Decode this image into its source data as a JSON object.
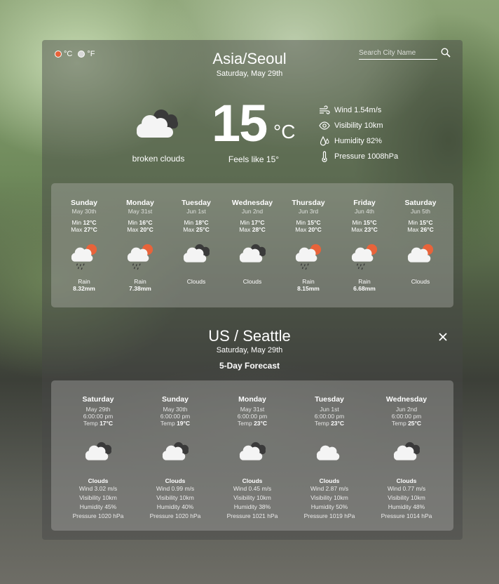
{
  "units": {
    "celsius": "°C",
    "fahrenheit": "°F",
    "celsius_color": "#e8633a",
    "fahrenheit_color": "#d8d8d8"
  },
  "search": {
    "placeholder": "Search City Name"
  },
  "current": {
    "city": "Asia/Seoul",
    "date": "Saturday, May 29th",
    "temp": "15",
    "temp_unit": "°C",
    "description": "broken clouds",
    "feels_like": "Feels like 15°",
    "icon": "cloud-dark-icon",
    "details": {
      "wind": "Wind 1.54m/s",
      "visibility": "Visibility 10km",
      "humidity": "Humidity 82%",
      "pressure": "Pressure 1008hPa"
    }
  },
  "week": [
    {
      "day": "Sunday",
      "date": "May 30th",
      "min_label": "Min",
      "min": "12°C",
      "max_label": "Max",
      "max": "27°C",
      "icon": "rain-sun-icon",
      "condition": "Rain",
      "amount": "8.32mm"
    },
    {
      "day": "Monday",
      "date": "May 31st",
      "min_label": "Min",
      "min": "16°C",
      "max_label": "Max",
      "max": "20°C",
      "icon": "rain-sun-icon",
      "condition": "Rain",
      "amount": "7.38mm"
    },
    {
      "day": "Tuesday",
      "date": "Jun 1st",
      "min_label": "Min",
      "min": "18°C",
      "max_label": "Max",
      "max": "25°C",
      "icon": "cloud-dark-icon",
      "condition": "Clouds",
      "amount": ""
    },
    {
      "day": "Wednesday",
      "date": "Jun 2nd",
      "min_label": "Min",
      "min": "17°C",
      "max_label": "Max",
      "max": "28°C",
      "icon": "cloud-dark-icon",
      "condition": "Clouds",
      "amount": ""
    },
    {
      "day": "Thursday",
      "date": "Jun 3rd",
      "min_label": "Min",
      "min": "15°C",
      "max_label": "Max",
      "max": "20°C",
      "icon": "rain-sun-icon",
      "condition": "Rain",
      "amount": "8.15mm"
    },
    {
      "day": "Friday",
      "date": "Jun 4th",
      "min_label": "Min",
      "min": "15°C",
      "max_label": "Max",
      "max": "23°C",
      "icon": "rain-sun-icon",
      "condition": "Rain",
      "amount": "6.68mm"
    },
    {
      "day": "Saturday",
      "date": "Jun 5th",
      "min_label": "Min",
      "min": "15°C",
      "max_label": "Max",
      "max": "26°C",
      "icon": "cloud-sun-icon",
      "condition": "Clouds",
      "amount": ""
    }
  ],
  "seattle": {
    "city": "US / Seattle",
    "date": "Saturday, May 29th",
    "forecast_title": "5-Day Forecast",
    "days": [
      {
        "day": "Saturday",
        "date": "May 29th",
        "time": "6:00:00 pm",
        "temp_label": "Temp",
        "temp": "17°C",
        "icon": "cloud-dark-icon",
        "condition": "Clouds",
        "wind": "Wind 3.02 m/s",
        "visibility": "Visibility 10km",
        "humidity": "Humidity 45%",
        "pressure": "Pressure 1020 hPa"
      },
      {
        "day": "Sunday",
        "date": "May 30th",
        "time": "6:00:00 pm",
        "temp_label": "Temp",
        "temp": "19°C",
        "icon": "cloud-dark-icon",
        "condition": "Clouds",
        "wind": "Wind 0.99 m/s",
        "visibility": "Visibility 10km",
        "humidity": "Humidity 40%",
        "pressure": "Pressure 1020 hPa"
      },
      {
        "day": "Monday",
        "date": "May 31st",
        "time": "6:00:00 pm",
        "temp_label": "Temp",
        "temp": "23°C",
        "icon": "cloud-dark-icon",
        "condition": "Clouds",
        "wind": "Wind 0.45 m/s",
        "visibility": "Visibility 10km",
        "humidity": "Humidity 38%",
        "pressure": "Pressure 1021 hPa"
      },
      {
        "day": "Tuesday",
        "date": "Jun 1st",
        "time": "6:00:00 pm",
        "temp_label": "Temp",
        "temp": "23°C",
        "icon": "cloud-icon",
        "condition": "Clouds",
        "wind": "Wind 2.87 m/s",
        "visibility": "Visibility 10km",
        "humidity": "Humidity 50%",
        "pressure": "Pressure 1019 hPa"
      },
      {
        "day": "Wednesday",
        "date": "Jun 2nd",
        "time": "6:00:00 pm",
        "temp_label": "Temp",
        "temp": "25°C",
        "icon": "cloud-dark-icon",
        "condition": "Clouds",
        "wind": "Wind 0.77 m/s",
        "visibility": "Visibility 10km",
        "humidity": "Humidity 48%",
        "pressure": "Pressure 1014 hPa"
      }
    ]
  }
}
